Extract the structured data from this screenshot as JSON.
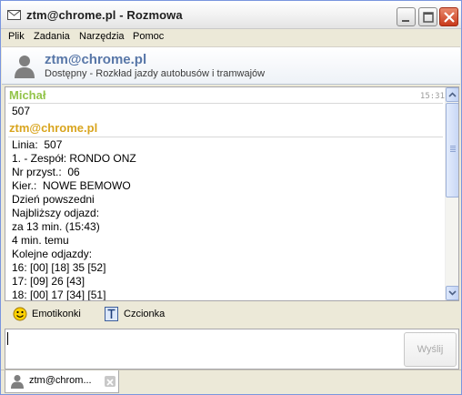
{
  "window": {
    "title": "ztm@chrome.pl - Rozmowa"
  },
  "menu": {
    "items": [
      "Plik",
      "Zadania",
      "Narzędzia",
      "Pomoc"
    ]
  },
  "contact": {
    "name": "ztm@chrome.pl",
    "status": "Dostępny - Rozkład jazdy autobusów i tramwajów",
    "avatar_icon": "person-silhouette-icon"
  },
  "chat": {
    "messages": [
      {
        "sender": "Michał",
        "time": "15:31",
        "lines": [
          "507"
        ]
      },
      {
        "sender": "ztm@chrome.pl",
        "lines": [
          "Linia:  507",
          "1. - Zespół: RONDO ONZ",
          "Nr przyst.:  06",
          "Kier.:  NOWE BEMOWO",
          "Dzień powszedni",
          "Najbliższy odjazd:",
          "za 13 min. (15:43)",
          "4 min. temu",
          "Kolejne odjazdy:",
          "16: [00] [18] 35 [52]",
          "17: [09] 26 [43]",
          "18: [00] 17 [34] [51]"
        ]
      }
    ],
    "sender_colors": {
      "michal": "#93C44A",
      "ztm": "#D9A51F"
    }
  },
  "toolbar": {
    "emoticons_label": "Emotikonki",
    "emoticons_icon": "smiley-icon",
    "font_label": "Czcionka",
    "font_icon": "font-icon"
  },
  "input": {
    "value": "",
    "send_label": "Wyślij"
  },
  "tabs": [
    {
      "label": "ztm@chrom...",
      "icon": "person-icon"
    }
  ]
}
